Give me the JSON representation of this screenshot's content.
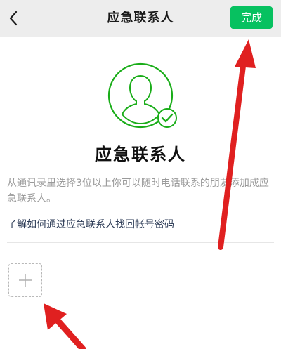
{
  "navbar": {
    "title": "应急联系人",
    "done_label": "完成",
    "back_icon": "chevron-left-icon",
    "done_color": "#07c160",
    "background": "#ededed"
  },
  "main": {
    "avatar_icon": "person-check-icon",
    "avatar_color": "#1aad19",
    "title": "应急联系人",
    "description": "从通讯录里选择3位以上你可以随时电话联系的朋友添加成应急联系人。",
    "help_link": "了解如何通过应急联系人找回帐号密码",
    "add_icon": "plus-icon"
  },
  "annotations": {
    "arrow_color": "#e02020"
  }
}
